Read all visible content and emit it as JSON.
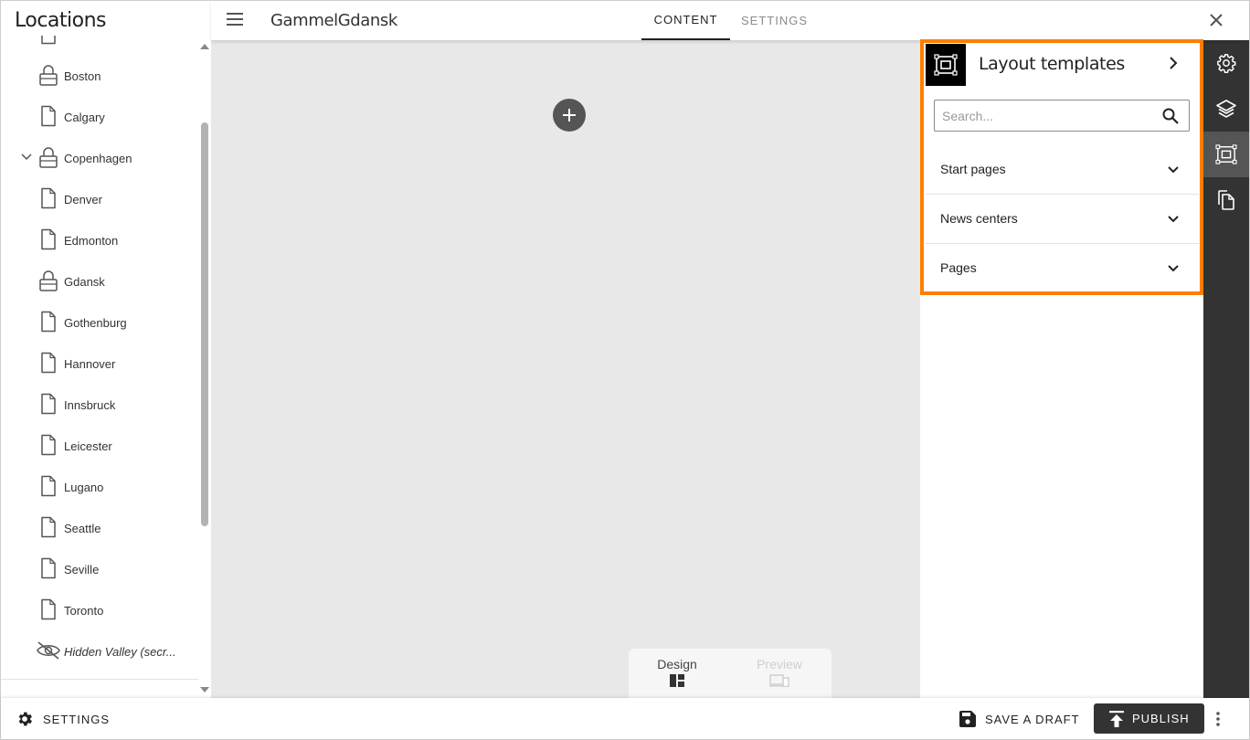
{
  "sidebar": {
    "title": "Locations",
    "items": [
      {
        "label": "Boston",
        "icon": "lock-icon"
      },
      {
        "label": "Calgary",
        "icon": "page-icon"
      },
      {
        "label": "Copenhagen",
        "icon": "lock-icon",
        "expanded": true
      },
      {
        "label": "Denver",
        "icon": "page-icon"
      },
      {
        "label": "Edmonton",
        "icon": "page-icon"
      },
      {
        "label": "Gdansk",
        "icon": "lock-icon"
      },
      {
        "label": "Gothenburg",
        "icon": "page-icon"
      },
      {
        "label": "Hannover",
        "icon": "page-icon"
      },
      {
        "label": "Innsbruck",
        "icon": "page-icon"
      },
      {
        "label": "Leicester",
        "icon": "page-icon"
      },
      {
        "label": "Lugano",
        "icon": "page-icon"
      },
      {
        "label": "Seattle",
        "icon": "page-icon"
      },
      {
        "label": "Seville",
        "icon": "page-icon"
      },
      {
        "label": "Toronto",
        "icon": "page-icon"
      },
      {
        "label": "Hidden Valley (secr...",
        "icon": "eye-off-icon"
      }
    ]
  },
  "header": {
    "page_name": "GammelGdansk",
    "tabs": [
      {
        "label": "CONTENT",
        "active": true
      },
      {
        "label": "SETTINGS",
        "active": false
      }
    ]
  },
  "canvas": {
    "modes": [
      {
        "label": "Design",
        "active": true
      },
      {
        "label": "Preview",
        "active": false
      }
    ]
  },
  "layout_panel": {
    "title": "Layout templates",
    "search_placeholder": "Search...",
    "sections": [
      {
        "label": "Start pages"
      },
      {
        "label": "News centers"
      },
      {
        "label": "Pages"
      }
    ],
    "highlight_color": "#ff7f00"
  },
  "rail": {
    "buttons": [
      {
        "icon": "gear-icon",
        "active": false
      },
      {
        "icon": "layers-icon",
        "active": false
      },
      {
        "icon": "layout-template-icon",
        "active": true
      },
      {
        "icon": "copy-icon",
        "active": false
      }
    ]
  },
  "footer": {
    "settings_label": "SETTINGS",
    "save_draft_label": "SAVE A DRAFT",
    "publish_label": "PUBLISH"
  },
  "colors": {
    "rail_bg": "#333333",
    "rail_active": "#555555",
    "canvas_bg": "#e8e8e8",
    "publish_bg": "#333333"
  }
}
